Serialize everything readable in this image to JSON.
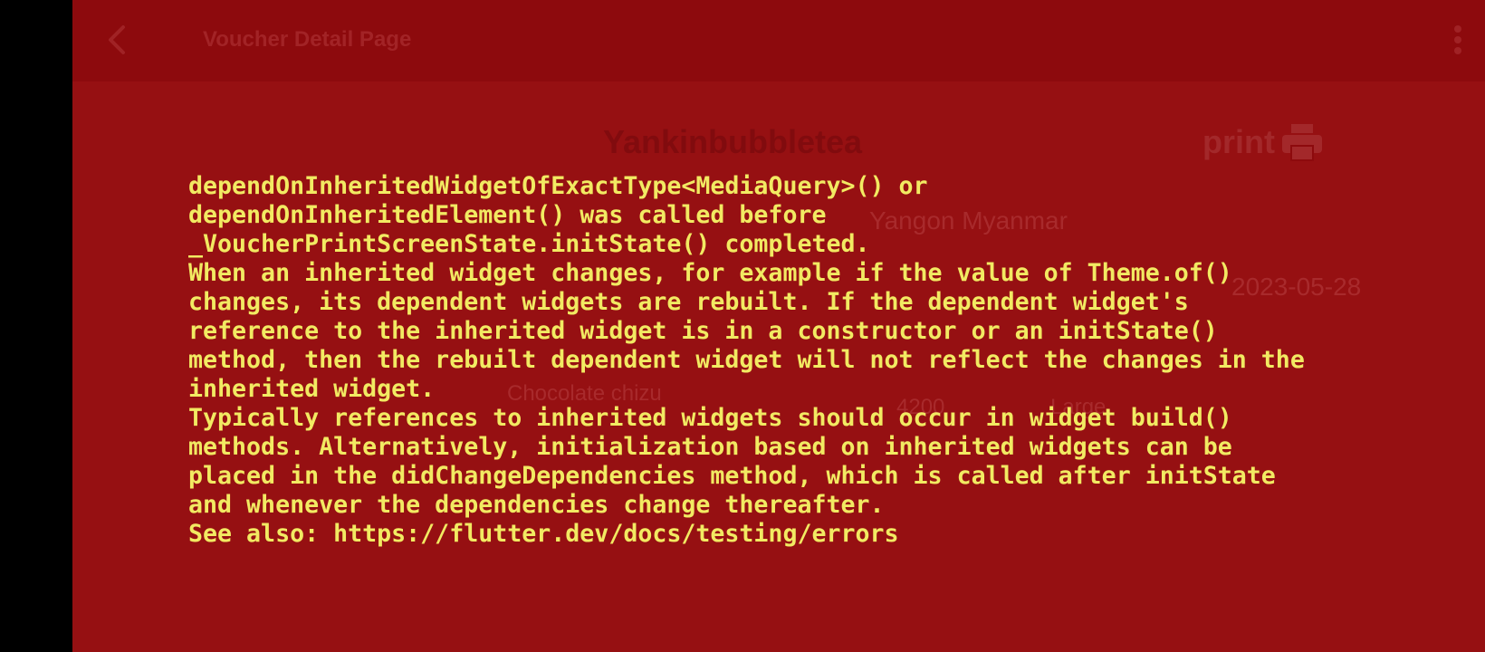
{
  "app_bar": {
    "title": "Voucher Detail Page",
    "back_icon": "back-arrow-icon",
    "more_icon": "more-vert-icon"
  },
  "voucher": {
    "shop_name": "Yankinbubbletea",
    "print_label": "print",
    "print_icon": "printer-icon",
    "address": "Yangon Myanmar",
    "date": "2023-05-28",
    "item_name": "Chocolate chizu",
    "item_price": "4200",
    "item_size": "Large"
  },
  "error": {
    "lines": [
      "dependOnInheritedWidgetOfExactType<MediaQuery>() or",
      "dependOnInheritedElement() was called before",
      "_VoucherPrintScreenState.initState() completed.",
      "When an inherited widget changes, for example if the value of Theme.of()",
      "changes, its dependent widgets are rebuilt. If the dependent widget's",
      "reference to the inherited widget is in a constructor or an initState()",
      "method, then the rebuilt dependent widget will not reflect the changes in the",
      "inherited widget.",
      "Typically references to inherited widgets should occur in widget build()",
      "methods. Alternatively, initialization based on inherited widgets can be",
      "placed in the didChangeDependencies method, which is called after initState",
      "and whenever the dependencies change thereafter.",
      "See also: https://flutter.dev/docs/testing/errors"
    ]
  },
  "colors": {
    "error_background": "#961012",
    "app_bar": "#8d0a0d",
    "error_text": "#f2ea62",
    "system_bar": "#000000"
  }
}
